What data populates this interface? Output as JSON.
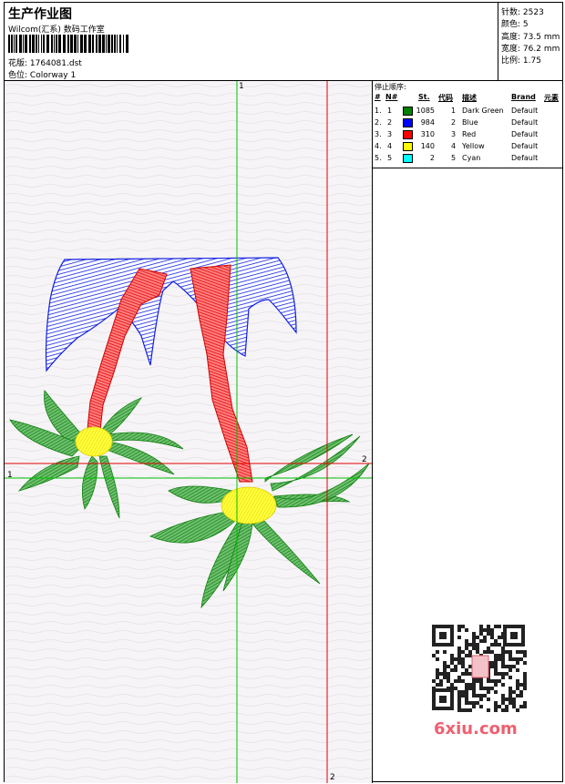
{
  "header": {
    "title": "生产作业图",
    "company": "Wilcom(汇系) 数码工作室",
    "design_label": "花版:",
    "design_value": "1764081.dst",
    "colorway_label": "色位:",
    "colorway_value": "Colorway 1"
  },
  "stats": [
    {
      "label": "针数:",
      "value": "2523"
    },
    {
      "label": "颜色:",
      "value": "5"
    },
    {
      "label": "高度:",
      "value": "73.5 mm"
    },
    {
      "label": "宽度:",
      "value": "76.2 mm"
    },
    {
      "label": "比例:",
      "value": "1.75"
    }
  ],
  "stop_panel": {
    "title": "停止顺序:",
    "columns": {
      "num": "#",
      "no": "N#",
      "st": "St.",
      "code": "代码",
      "desc": "描述",
      "brand": "Brand",
      "element": "元素"
    },
    "rows": [
      {
        "num": "1.",
        "no": "1",
        "color": "#008000",
        "st": "1085",
        "code": "1",
        "desc": "Dark Green",
        "brand": "Default"
      },
      {
        "num": "2.",
        "no": "2",
        "color": "#0000ff",
        "st": "984",
        "code": "2",
        "desc": "Blue",
        "brand": "Default"
      },
      {
        "num": "3.",
        "no": "3",
        "color": "#ff0000",
        "st": "310",
        "code": "3",
        "desc": "Red",
        "brand": "Default"
      },
      {
        "num": "4.",
        "no": "4",
        "color": "#ffff00",
        "st": "140",
        "code": "4",
        "desc": "Yellow",
        "brand": "Default"
      },
      {
        "num": "5.",
        "no": "5",
        "color": "#00ffff",
        "st": "2",
        "code": "5",
        "desc": "Cyan",
        "brand": "Default"
      }
    ]
  },
  "guides": {
    "green_label": "1",
    "red_label": "2"
  },
  "watermark": {
    "url": "6xiu.com"
  }
}
